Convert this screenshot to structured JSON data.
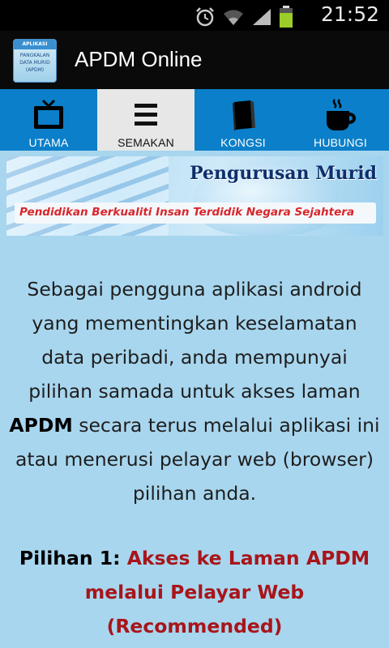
{
  "status_bar": {
    "time": "21:52",
    "icons": [
      "alarm-icon",
      "wifi-icon",
      "signal-icon",
      "battery-icon"
    ]
  },
  "action_bar": {
    "title": "APDM Online",
    "app_icon": {
      "top": "APLIKASI",
      "line1": "PANGKALAN",
      "line2": "DATA MURID",
      "line3": "(APDM)"
    }
  },
  "tabs": [
    {
      "label": "UTAMA",
      "icon": "tv-icon",
      "active": false
    },
    {
      "label": "SEMAKAN",
      "icon": "menu-icon",
      "active": true
    },
    {
      "label": "KONGSI",
      "icon": "book-icon",
      "active": false
    },
    {
      "label": "HUBUNGI",
      "icon": "coffee-cup-icon",
      "active": false
    }
  ],
  "banner": {
    "headline": "Pengurusan Murid",
    "tagline": "Pendidikan Berkualiti Insan Terdidik Negara Sejahtera"
  },
  "content": {
    "para_before": "Sebagai pengguna aplikasi android yang mementingkan keselamatan data peribadi, anda mempunyai pilihan samada untuk akses laman",
    "bold_word": "APDM",
    "para_after": "secara terus melalui aplikasi ini atau menerusi pelayar web (browser) pilihan anda."
  },
  "option1": {
    "lead": "Pilihan 1:",
    "text": "Akses ke Laman APDM melalui Pelayar Web (Recommended)"
  },
  "colors": {
    "tab_bar": "#0b7fc9",
    "tab_active": "#e7e7e7",
    "page_bg": "#a8d6ee",
    "accent_red": "#a8151a"
  }
}
